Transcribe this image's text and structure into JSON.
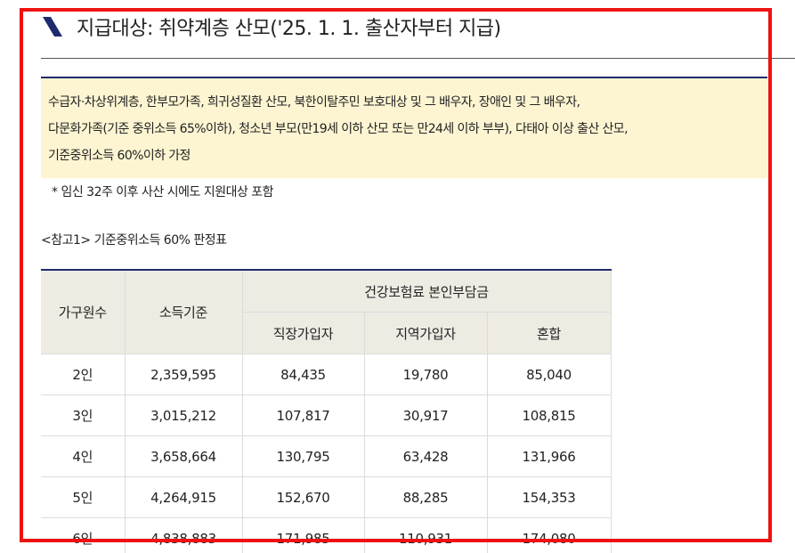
{
  "section": {
    "title": "지급대상: 취약계층 산모('25. 1. 1. 출산자부터 지급)"
  },
  "notice": {
    "lines": [
      "수급자·차상위계층, 한부모가족, 희귀성질환 산모, 북한이탈주민 보호대상 및 그 배우자, 장애인 및 그 배우자,",
      "다문화가족(기준 중위소득 65%이하), 청소년 부모(만19세 이하 산모 또는 만24세 이하 부부), 다태아 이상 출산 산모,",
      "기준중위소득 60%이하 가정"
    ],
    "footnote": "* 임신 32주 이후 사산 시에도 지원대상 포함"
  },
  "reference": {
    "title": "<참고1> 기준중위소득 60% 판정표"
  },
  "table": {
    "headers": {
      "household": "가구원수",
      "income": "소득기준",
      "insurance_group": "건강보험료 본인부담금",
      "employee": "직장가입자",
      "regional": "지역가입자",
      "mixed": "혼합"
    },
    "rows": [
      [
        "2인",
        "2,359,595",
        "84,435",
        "19,780",
        "85,040"
      ],
      [
        "3인",
        "3,015,212",
        "107,817",
        "30,917",
        "108,815"
      ],
      [
        "4인",
        "3,658,664",
        "130,795",
        "63,428",
        "131,966"
      ],
      [
        "5인",
        "4,264,915",
        "152,670",
        "88,285",
        "154,353"
      ],
      [
        "6인",
        "4,838,883",
        "171,985",
        "110,931",
        "174,080"
      ]
    ]
  },
  "colors": {
    "accent_navy": "#1e2a6e",
    "notice_bg": "#fdf5d2",
    "header_bg": "#eeebe3",
    "highlight_frame": "#ee1111"
  }
}
